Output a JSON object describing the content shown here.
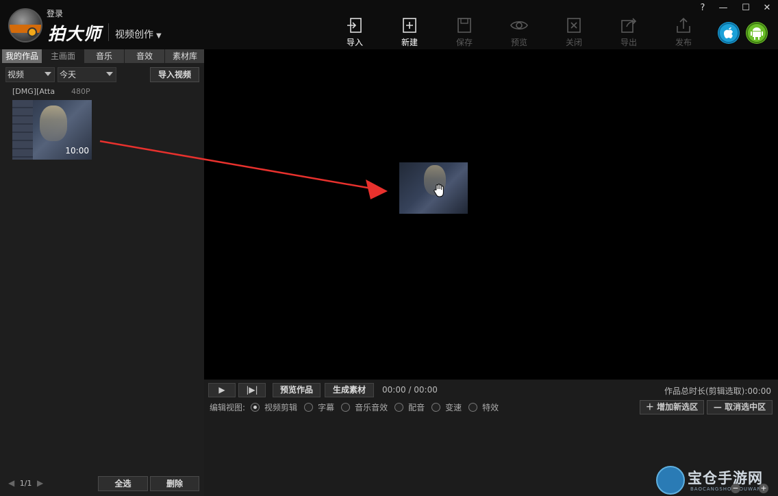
{
  "header": {
    "login": "登录",
    "brand": "拍大师",
    "mode": "视频创作"
  },
  "toolbar": [
    {
      "label": "导入",
      "icon": "import-icon",
      "state": "active"
    },
    {
      "label": "新建",
      "icon": "new-icon",
      "state": "active"
    },
    {
      "label": "保存",
      "icon": "save-icon",
      "state": "disabled"
    },
    {
      "label": "预览",
      "icon": "preview-icon",
      "state": "disabled"
    },
    {
      "label": "关闭",
      "icon": "close-file-icon",
      "state": "disabled"
    },
    {
      "label": "导出",
      "icon": "export-icon",
      "state": "disabled"
    },
    {
      "label": "发布",
      "icon": "publish-icon",
      "state": "disabled"
    }
  ],
  "window_controls": [
    "?",
    "—",
    "☐",
    "✕"
  ],
  "os_buttons": {
    "ios_color": "#1ba1d8",
    "android_color": "#6cbf2a"
  },
  "left_panel": {
    "tabs": [
      "我的作品",
      "主画面",
      "音乐",
      "音效",
      "素材库"
    ],
    "type_filter": "视频",
    "date_filter": "今天",
    "import_button": "导入视频",
    "media": [
      {
        "name": "[DMG][Atta",
        "resolution": "480P",
        "duration": "10:00"
      }
    ],
    "pager": {
      "text": "1/1"
    },
    "select_all": "全选",
    "delete": "删除"
  },
  "timeline": {
    "play": "▶",
    "step": "|▶|",
    "preview_work": "预览作品",
    "generate": "生成素材",
    "time": "00:00 / 00:00",
    "total": "作品总时长(剪辑选取):00:00",
    "view_label": "编辑视图:",
    "views": [
      "视频剪辑",
      "字幕",
      "音乐音效",
      "配音",
      "变速",
      "特效"
    ],
    "selected_view": 0,
    "add_zone": "增加新选区",
    "cancel_zone": "取消选中区"
  },
  "watermark": {
    "title": "宝仓手游网",
    "sub": "BAOCANGSHOUYOUWANG"
  },
  "colors": {
    "arrow": "#e8312d",
    "accent_tab": "#6e6e6e"
  }
}
